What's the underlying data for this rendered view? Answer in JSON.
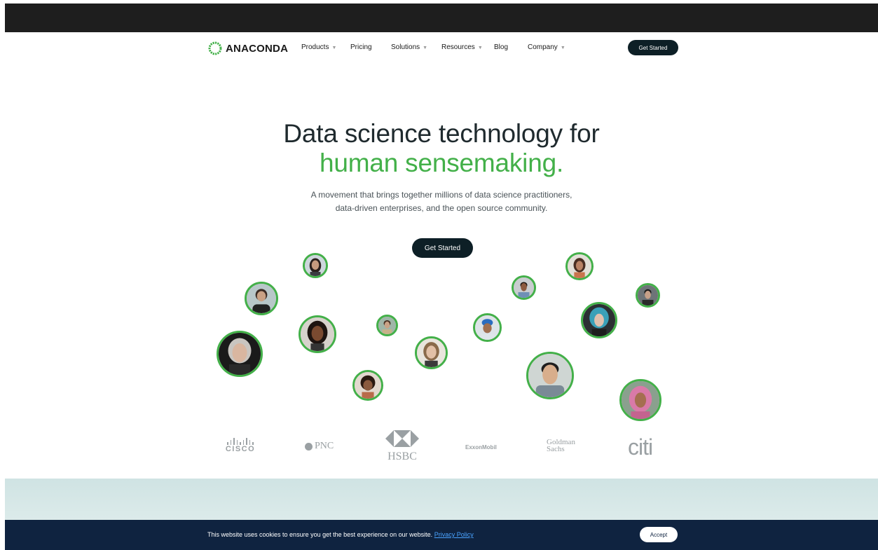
{
  "nav": {
    "logo_text": "ANACONDA",
    "items": [
      {
        "label": "Products",
        "has_dropdown": true
      },
      {
        "label": "Pricing",
        "has_dropdown": false
      },
      {
        "label": "Solutions",
        "has_dropdown": true
      },
      {
        "label": "Resources",
        "has_dropdown": true
      },
      {
        "label": "Blog",
        "has_dropdown": false
      },
      {
        "label": "Company",
        "has_dropdown": true
      }
    ],
    "cta_label": "Get Started"
  },
  "hero": {
    "title_line1": "Data science technology for",
    "title_line2": "human sensemaking.",
    "subtitle_line1": "A movement that brings together millions of data science practitioners,",
    "subtitle_line2": "data-driven enterprises, and the open source community.",
    "cta_label": "Get Started"
  },
  "logos": {
    "cisco": "CISCO",
    "pnc": "PNC",
    "hsbc": "HSBC",
    "exxon": "ExxonMobil",
    "goldman_line1": "Goldman",
    "goldman_line2": "Sachs",
    "citi": "citi"
  },
  "cookie": {
    "text": "This website uses cookies to ensure you get the best experience on our website.",
    "link_label": "Privacy Policy",
    "accept_label": "Accept"
  },
  "colors": {
    "accent_green": "#43b049",
    "dark": "#0d1f26",
    "cookie_bg": "#0f2340",
    "link_blue": "#4aa3ff"
  }
}
